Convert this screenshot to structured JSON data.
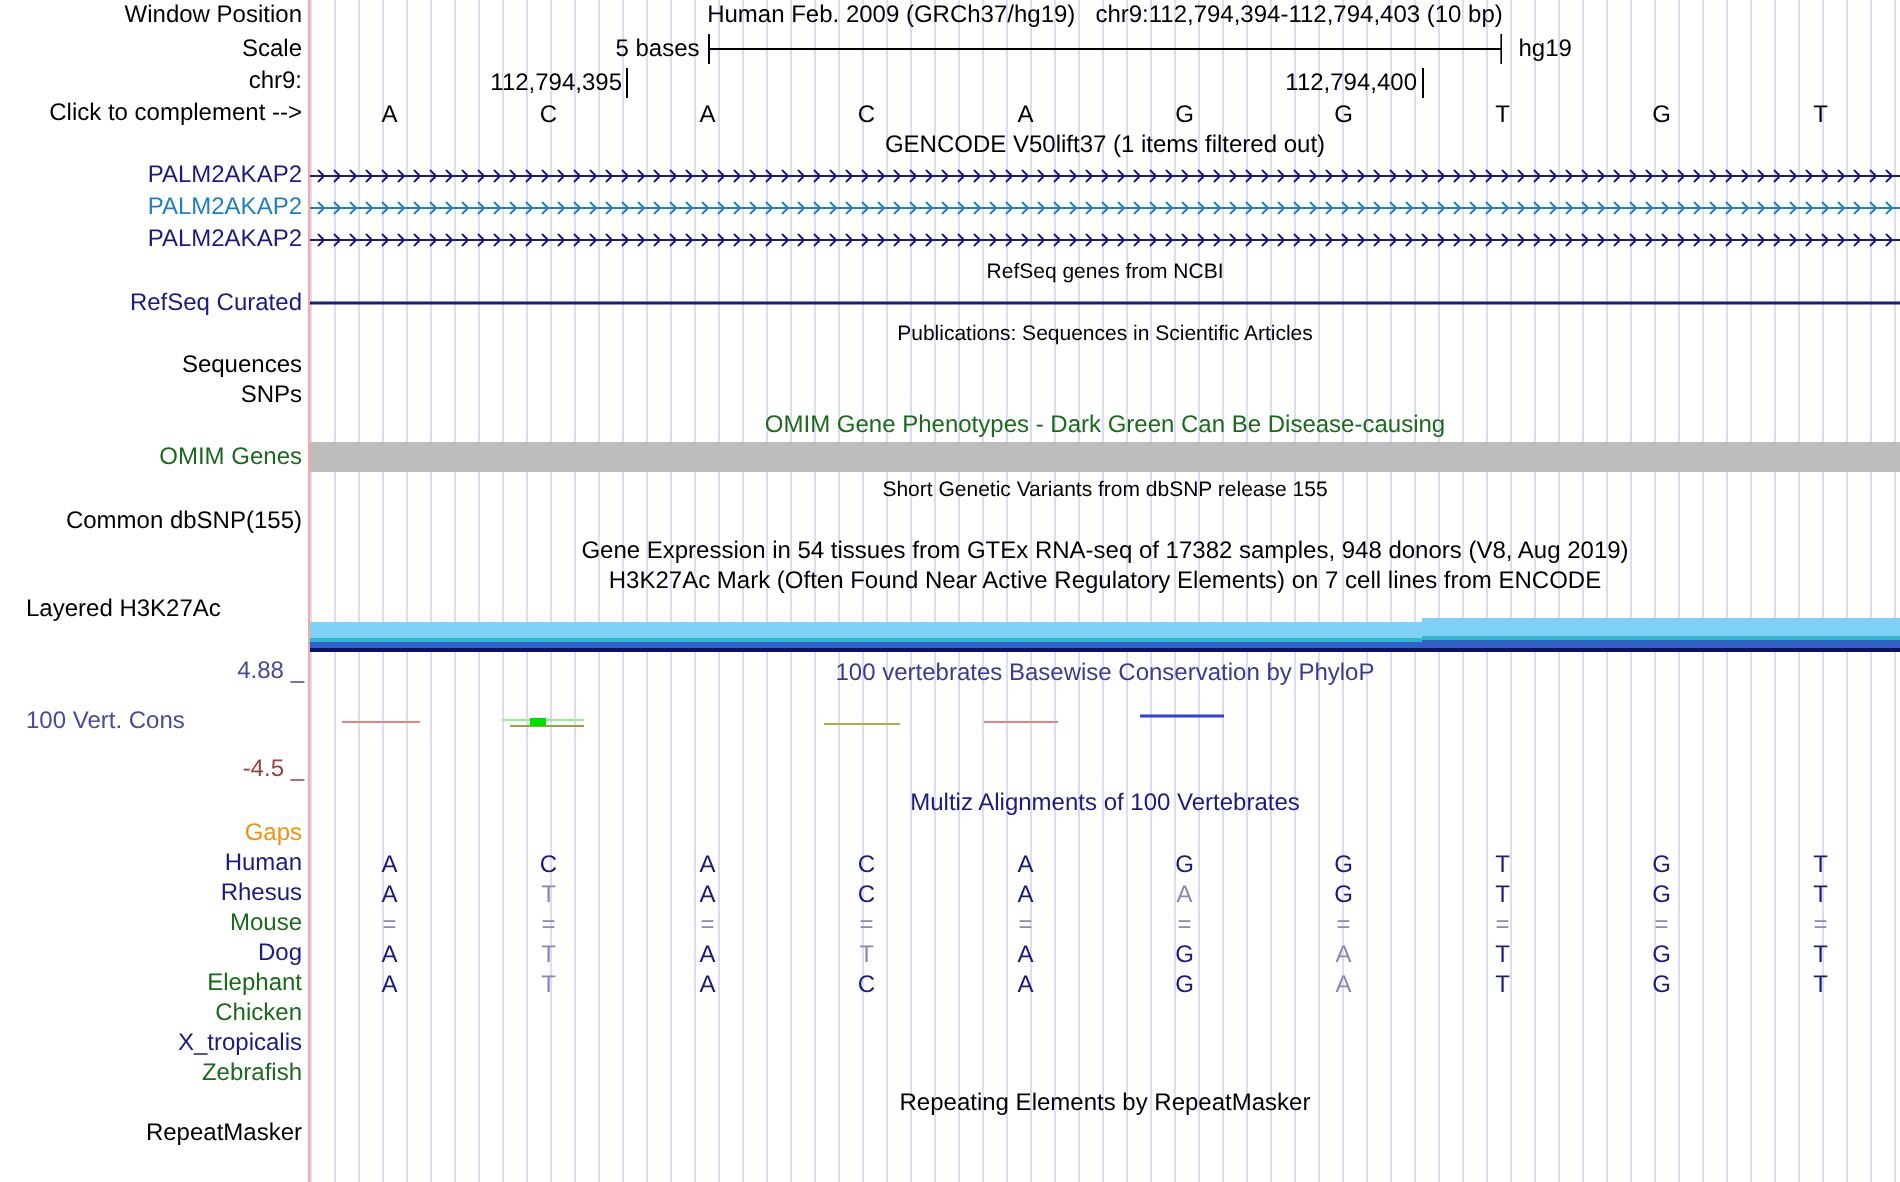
{
  "header": {
    "label": "Window Position",
    "title": "Human Feb. 2009 (GRCh37/hg19)",
    "position": "chr9:112,794,394-112,794,403 (10 bp)"
  },
  "scale": {
    "label": "Scale",
    "bar_label": "5 bases",
    "assembly": "hg19"
  },
  "chromosome": {
    "label": "chr9:",
    "ticks": [
      "112,794,395",
      "112,794,400"
    ]
  },
  "complement": {
    "label": "Click to complement -->",
    "bases": [
      "A",
      "C",
      "A",
      "C",
      "A",
      "G",
      "G",
      "T",
      "G",
      "T"
    ]
  },
  "tracks": [
    {
      "kind": "gene",
      "title": "GENCODE V50lift37 (1 items filtered out)",
      "items": [
        {
          "name": "PALM2AKAP2",
          "color": "#1a1a80"
        },
        {
          "name": "PALM2AKAP2",
          "color": "#1f7fc0"
        },
        {
          "name": "PALM2AKAP2",
          "color": "#1a1a80"
        }
      ]
    },
    {
      "kind": "line",
      "title": "RefSeq genes from NCBI",
      "label": "RefSeq Curated"
    },
    {
      "kind": "dense",
      "title": "Publications: Sequences in Scientific Articles",
      "labels": [
        "Sequences",
        "SNPs"
      ]
    },
    {
      "kind": "bar",
      "title": "OMIM Gene Phenotypes - Dark Green Can Be Disease-causing",
      "label": "OMIM Genes"
    },
    {
      "kind": "dense",
      "title": "Short Genetic Variants from dbSNP release 155",
      "labels": [
        "Common dbSNP(155)"
      ]
    },
    {
      "kind": "layered",
      "titles": [
        "Gene Expression in 54 tissues from GTEx RNA-seq of 17382 samples, 948 donors (V8, Aug 2019)",
        "H3K27Ac Mark (Often Found Near Active Regulatory Elements) on 7 cell lines from ENCODE"
      ],
      "label": "Layered H3K27Ac"
    },
    {
      "kind": "wiggle",
      "title": "100 vertebrates Basewise Conservation by PhyloP",
      "label": "100 Vert. Cons",
      "max": "4.88 _",
      "min": "-4.5 _"
    },
    {
      "kind": "alignment",
      "title": "Multiz Alignments of 100 Vertebrates",
      "gaps_label": "Gaps",
      "species": [
        {
          "name": "Human",
          "color": "#1a1a80",
          "bases": [
            {
              "base": "A",
              "match": true
            },
            {
              "base": "C",
              "match": true
            },
            {
              "base": "A",
              "match": true
            },
            {
              "base": "C",
              "match": true
            },
            {
              "base": "A",
              "match": true
            },
            {
              "base": "G",
              "match": true
            },
            {
              "base": "G",
              "match": true
            },
            {
              "base": "T",
              "match": true
            },
            {
              "base": "G",
              "match": true
            },
            {
              "base": "T",
              "match": true
            }
          ]
        },
        {
          "name": "Rhesus",
          "color": "#1a1a80",
          "bases": [
            {
              "base": "A",
              "match": true
            },
            {
              "base": "T",
              "match": false
            },
            {
              "base": "A",
              "match": true
            },
            {
              "base": "C",
              "match": true
            },
            {
              "base": "A",
              "match": true
            },
            {
              "base": "A",
              "match": false
            },
            {
              "base": "G",
              "match": true
            },
            {
              "base": "T",
              "match": true
            },
            {
              "base": "G",
              "match": true
            },
            {
              "base": "T",
              "match": true
            }
          ]
        },
        {
          "name": "Mouse",
          "color": "#1a6a1a",
          "bases": [
            {
              "base": "=",
              "match": false
            },
            {
              "base": "=",
              "match": false
            },
            {
              "base": "=",
              "match": false
            },
            {
              "base": "=",
              "match": false
            },
            {
              "base": "=",
              "match": false
            },
            {
              "base": "=",
              "match": false
            },
            {
              "base": "=",
              "match": false
            },
            {
              "base": "=",
              "match": false
            },
            {
              "base": "=",
              "match": false
            },
            {
              "base": "=",
              "match": false
            }
          ]
        },
        {
          "name": "Dog",
          "color": "#1a1a80",
          "bases": [
            {
              "base": "A",
              "match": true
            },
            {
              "base": "T",
              "match": false
            },
            {
              "base": "A",
              "match": true
            },
            {
              "base": "T",
              "match": false
            },
            {
              "base": "A",
              "match": true
            },
            {
              "base": "G",
              "match": true
            },
            {
              "base": "A",
              "match": false
            },
            {
              "base": "T",
              "match": true
            },
            {
              "base": "G",
              "match": true
            },
            {
              "base": "T",
              "match": true
            }
          ]
        },
        {
          "name": "Elephant",
          "color": "#1a6a1a",
          "bases": [
            {
              "base": "A",
              "match": true
            },
            {
              "base": "T",
              "match": false
            },
            {
              "base": "A",
              "match": true
            },
            {
              "base": "C",
              "match": true
            },
            {
              "base": "A",
              "match": true
            },
            {
              "base": "G",
              "match": true
            },
            {
              "base": "A",
              "match": false
            },
            {
              "base": "T",
              "match": true
            },
            {
              "base": "G",
              "match": true
            },
            {
              "base": "T",
              "match": true
            }
          ]
        },
        {
          "name": "Chicken",
          "color": "#1a6a1a"
        },
        {
          "name": "X_tropicalis",
          "color": "#1a1a80"
        },
        {
          "name": "Zebrafish",
          "color": "#1a6a1a"
        }
      ]
    },
    {
      "kind": "empty",
      "title": "Repeating Elements by RepeatMasker",
      "labels": [
        "RepeatMasker"
      ]
    }
  ]
}
